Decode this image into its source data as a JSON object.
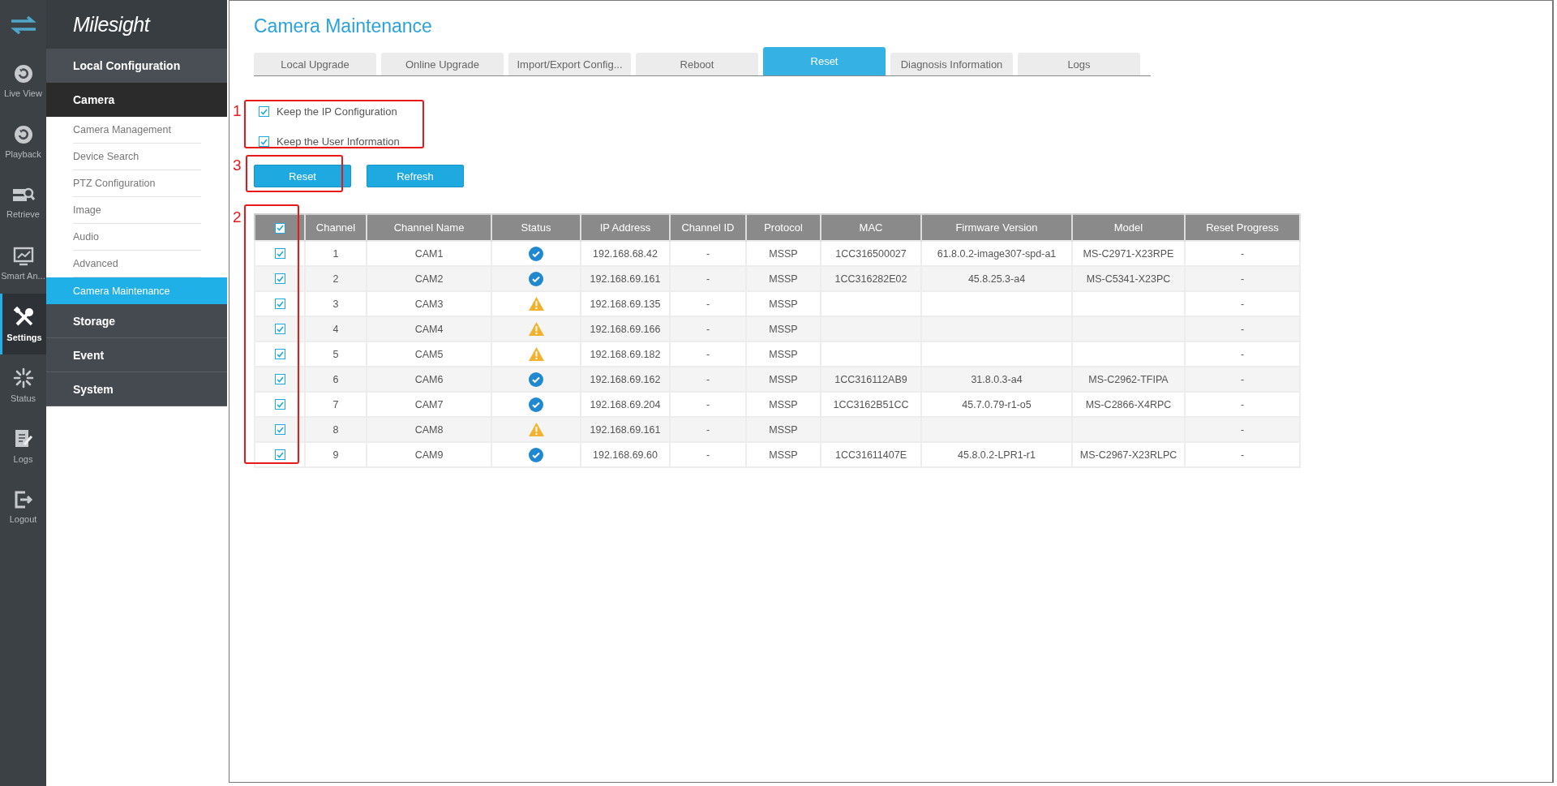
{
  "nav_rail": {
    "items": [
      {
        "label": "Live View",
        "selected": false
      },
      {
        "label": "Playback",
        "selected": false
      },
      {
        "label": "Retrieve",
        "selected": false
      },
      {
        "label": "Smart An...",
        "selected": false
      },
      {
        "label": "Settings",
        "selected": true
      },
      {
        "label": "Status",
        "selected": false
      },
      {
        "label": "Logs",
        "selected": false
      },
      {
        "label": "Logout",
        "selected": false
      }
    ]
  },
  "sidebar": {
    "logo": "Milesight",
    "title": "Local Configuration",
    "groups": [
      {
        "label": "Camera",
        "expanded": true,
        "children": [
          {
            "label": "Camera Management",
            "selected": false
          },
          {
            "label": "Device Search",
            "selected": false
          },
          {
            "label": "PTZ Configuration",
            "selected": false
          },
          {
            "label": "Image",
            "selected": false
          },
          {
            "label": "Audio",
            "selected": false
          },
          {
            "label": "Advanced",
            "selected": false
          },
          {
            "label": "Camera Maintenance",
            "selected": true
          }
        ]
      },
      {
        "label": "Storage",
        "expanded": false
      },
      {
        "label": "Event",
        "expanded": false
      },
      {
        "label": "System",
        "expanded": false
      }
    ]
  },
  "page": {
    "title": "Camera Maintenance",
    "tabs": [
      {
        "label": "Local Upgrade",
        "selected": false
      },
      {
        "label": "Online Upgrade",
        "selected": false
      },
      {
        "label": "Import/Export Config...",
        "selected": false
      },
      {
        "label": "Reboot",
        "selected": false
      },
      {
        "label": "Reset",
        "selected": true
      },
      {
        "label": "Diagnosis Information",
        "selected": false
      },
      {
        "label": "Logs",
        "selected": false
      }
    ],
    "options": [
      {
        "label": "Keep the IP Configuration",
        "checked": true
      },
      {
        "label": "Keep the User Information",
        "checked": true
      }
    ],
    "buttons": [
      "Reset",
      "Refresh"
    ],
    "table": {
      "select_all_checked": true,
      "columns": [
        "Channel",
        "Channel Name",
        "Status",
        "IP Address",
        "Channel ID",
        "Protocol",
        "MAC",
        "Firmware Version",
        "Model",
        "Reset Progress"
      ],
      "rows": [
        {
          "checked": true,
          "channel": "1",
          "name": "CAM1",
          "connected": true,
          "ip": "192.168.68.42",
          "channel_id": "-",
          "protocol": "MSSP",
          "mac": "1CC316500027",
          "firmware": "61.8.0.2-image307-spd-a1",
          "model": "MS-C2971-X23RPE",
          "reset_progress": "-"
        },
        {
          "checked": true,
          "channel": "2",
          "name": "CAM2",
          "connected": true,
          "ip": "192.168.69.161",
          "channel_id": "-",
          "protocol": "MSSP",
          "mac": "1CC316282E02",
          "firmware": "45.8.25.3-a4",
          "model": "MS-C5341-X23PC",
          "reset_progress": "-"
        },
        {
          "checked": true,
          "channel": "3",
          "name": "CAM3",
          "connected": false,
          "ip": "192.168.69.135",
          "channel_id": "-",
          "protocol": "MSSP",
          "reset_progress": "-"
        },
        {
          "checked": true,
          "channel": "4",
          "name": "CAM4",
          "connected": false,
          "ip": "192.168.69.166",
          "channel_id": "-",
          "protocol": "MSSP",
          "reset_progress": "-"
        },
        {
          "checked": true,
          "channel": "5",
          "name": "CAM5",
          "connected": false,
          "ip": "192.168.69.182",
          "channel_id": "-",
          "protocol": "MSSP",
          "reset_progress": "-"
        },
        {
          "checked": true,
          "channel": "6",
          "name": "CAM6",
          "connected": true,
          "ip": "192.168.69.162",
          "channel_id": "-",
          "protocol": "MSSP",
          "mac": "1CC316112AB9",
          "firmware": "31.8.0.3-a4",
          "model": "MS-C2962-TFIPA",
          "reset_progress": "-"
        },
        {
          "checked": true,
          "channel": "7",
          "name": "CAM7",
          "connected": true,
          "ip": "192.168.69.204",
          "channel_id": "-",
          "protocol": "MSSP",
          "mac": "1CC3162B51CC",
          "firmware": "45.7.0.79-r1-o5",
          "model": "MS-C2866-X4RPC",
          "reset_progress": "-"
        },
        {
          "checked": true,
          "channel": "8",
          "name": "CAM8",
          "connected": false,
          "ip": "192.168.69.161",
          "channel_id": "-",
          "protocol": "MSSP",
          "reset_progress": "-"
        },
        {
          "checked": true,
          "channel": "9",
          "name": "CAM9",
          "connected": true,
          "ip": "192.168.69.60",
          "channel_id": "-",
          "protocol": "MSSP",
          "mac": "1CC31611407E",
          "firmware": "45.8.0.2-LPR1-r1",
          "model": "MS-C2967-X23RLPC",
          "reset_progress": "-"
        }
      ]
    },
    "annotations": [
      {
        "label": "1"
      },
      {
        "label": "3"
      },
      {
        "label": "2"
      }
    ]
  }
}
